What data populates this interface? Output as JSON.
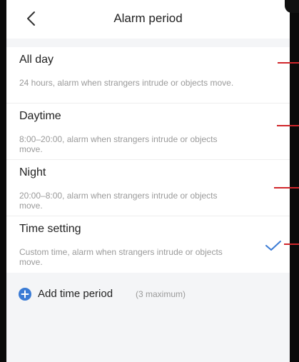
{
  "header": {
    "title": "Alarm period",
    "back_icon": "chevron-left-icon"
  },
  "options": [
    {
      "title": "All day",
      "description": "24 hours, alarm when strangers intrude or objects move.",
      "selected": false
    },
    {
      "title": "Daytime",
      "description": "8:00–20:00, alarm when strangers intrude or objects move.",
      "selected": false
    },
    {
      "title": "Night",
      "description": "20:00–8:00, alarm when strangers intrude or objects move.",
      "selected": false
    },
    {
      "title": "Time setting",
      "description": "Custom time, alarm when strangers intrude or objects move.",
      "selected": true
    }
  ],
  "add_period": {
    "label": "Add time period",
    "note": "(3 maximum)",
    "icon": "plus-circle-icon"
  },
  "colors": {
    "accent": "#3a7bd5",
    "annotation": "#d0262b"
  }
}
